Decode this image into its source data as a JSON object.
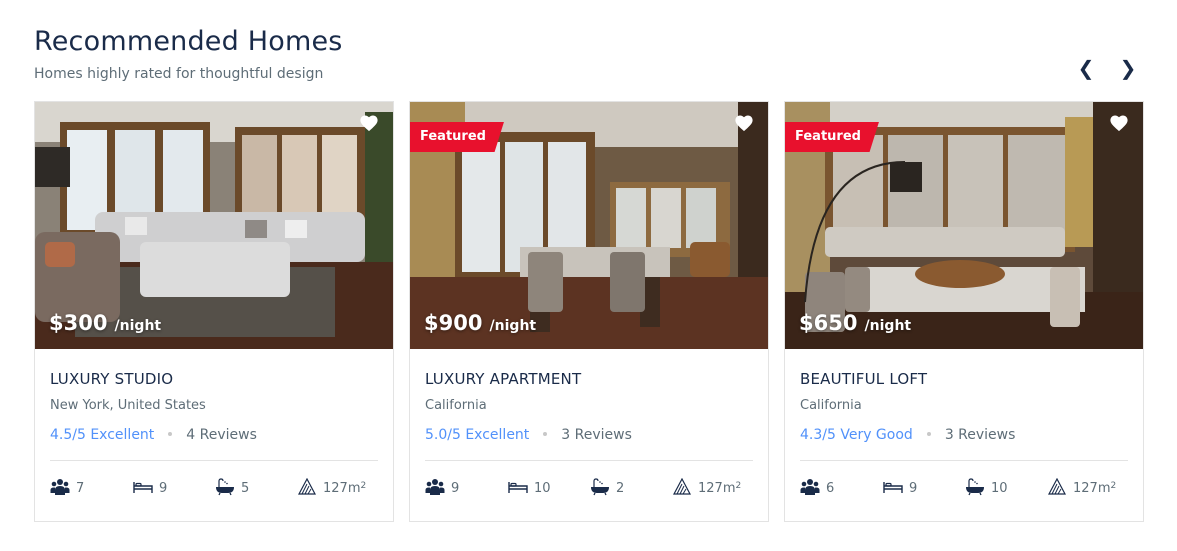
{
  "header": {
    "title": "Recommended Homes",
    "subtitle": "Homes highly rated for thoughtful design",
    "prev_arrow": "❮",
    "next_arrow": "❯"
  },
  "colors": {
    "title": "#1a2b49",
    "rating": "#5191fa",
    "badge": "#e8112d",
    "muted": "#5e6d77"
  },
  "cards": [
    {
      "featured": false,
      "price": "$300",
      "price_unit": "/night",
      "title": "LUXURY STUDIO",
      "location": "New York, United States",
      "rating": "4.5/5 Excellent",
      "reviews": "4 Reviews",
      "guests": "7",
      "beds": "9",
      "baths": "5",
      "area": "127m",
      "area_sup": "2",
      "icons": [
        "heart-icon",
        "guests-icon",
        "bed-icon",
        "bath-icon",
        "area-icon"
      ]
    },
    {
      "featured": true,
      "badge": "Featured",
      "price": "$900",
      "price_unit": "/night",
      "title": "LUXURY APARTMENT",
      "location": "California",
      "rating": "5.0/5 Excellent",
      "reviews": "3 Reviews",
      "guests": "9",
      "beds": "10",
      "baths": "2",
      "area": "127m",
      "area_sup": "2",
      "icons": [
        "heart-icon",
        "guests-icon",
        "bed-icon",
        "bath-icon",
        "area-icon"
      ]
    },
    {
      "featured": true,
      "badge": "Featured",
      "price": "$650",
      "price_unit": "/night",
      "title": "BEAUTIFUL LOFT",
      "location": "California",
      "rating": "4.3/5 Very Good",
      "reviews": "3 Reviews",
      "guests": "6",
      "beds": "9",
      "baths": "10",
      "area": "127m",
      "area_sup": "2",
      "icons": [
        "heart-icon",
        "guests-icon",
        "bed-icon",
        "bath-icon",
        "area-icon"
      ]
    }
  ]
}
